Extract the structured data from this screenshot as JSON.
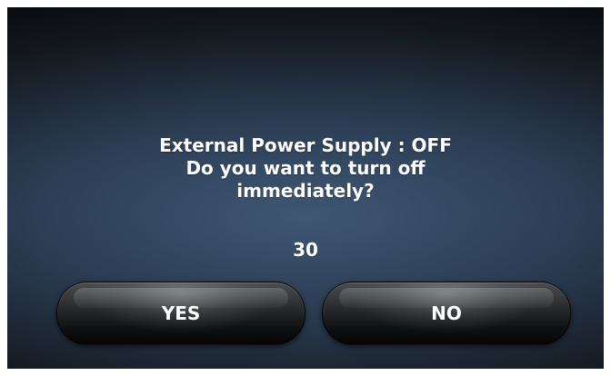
{
  "dialog": {
    "message_lines": [
      "External Power Supply : OFF",
      "Do you want to turn off",
      "immediately?"
    ],
    "countdown": "30",
    "buttons": {
      "yes": "YES",
      "no": "NO"
    }
  }
}
